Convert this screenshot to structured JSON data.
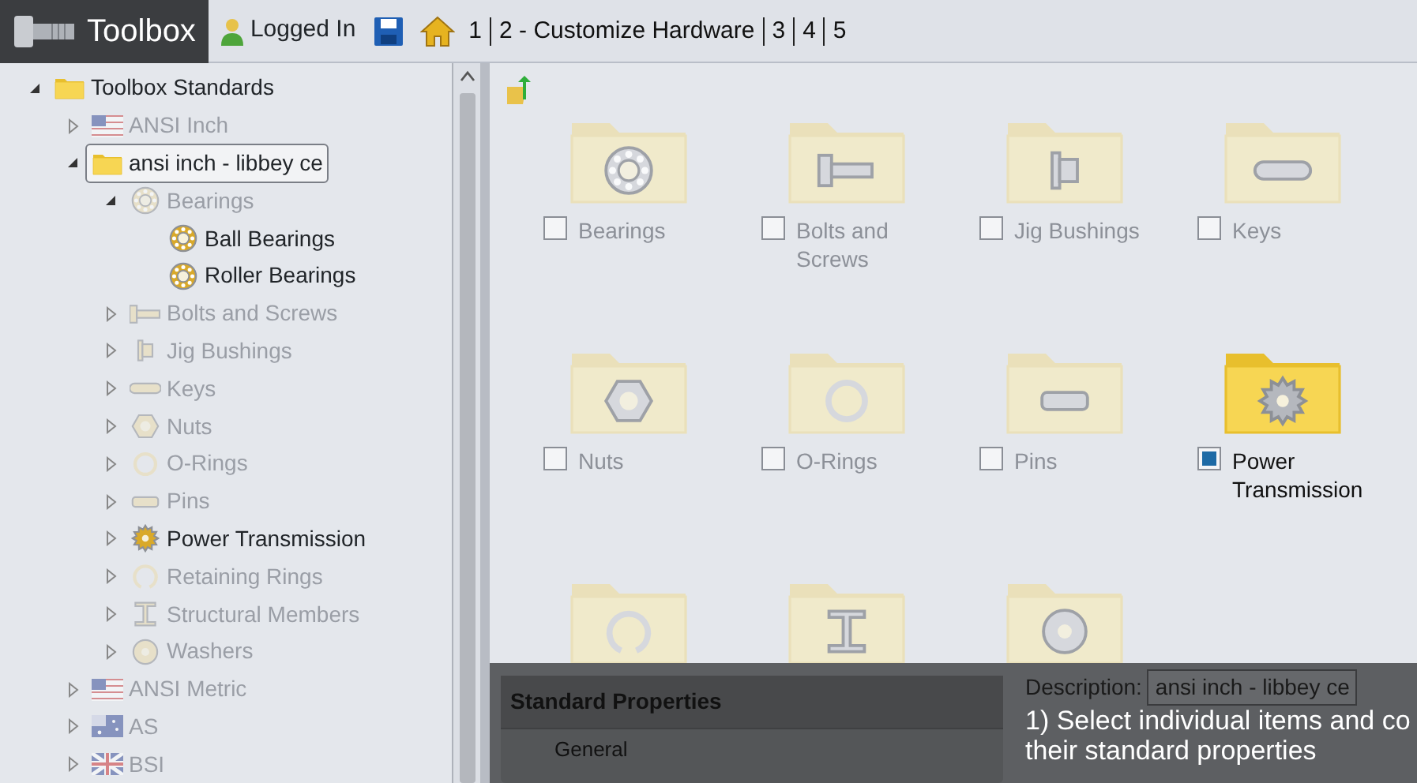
{
  "header": {
    "title": "Toolbox",
    "login": "Logged In",
    "steps": [
      {
        "label": "1"
      },
      {
        "label": "2 - Customize Hardware"
      },
      {
        "label": "3"
      },
      {
        "label": "4"
      },
      {
        "label": "5"
      }
    ]
  },
  "tree": [
    {
      "label": "Toolbox Standards",
      "enabled": true,
      "expanded": true,
      "selected": false,
      "children": [
        {
          "label": "ANSI Inch",
          "enabled": false,
          "expanded": false,
          "selected": false
        },
        {
          "label": "ansi inch - libbey ce",
          "enabled": true,
          "expanded": true,
          "selected": true,
          "children": [
            {
              "label": "Bearings",
              "enabled": false,
              "expanded": true,
              "selected": false,
              "children": [
                {
                  "label": "Ball Bearings",
                  "enabled": true,
                  "selected": false
                },
                {
                  "label": "Roller Bearings",
                  "enabled": true,
                  "selected": false
                }
              ]
            },
            {
              "label": "Bolts and Screws",
              "enabled": false,
              "expanded": false,
              "selected": false
            },
            {
              "label": "Jig Bushings",
              "enabled": false,
              "expanded": false,
              "selected": false
            },
            {
              "label": "Keys",
              "enabled": false,
              "expanded": false,
              "selected": false
            },
            {
              "label": "Nuts",
              "enabled": false,
              "expanded": false,
              "selected": false
            },
            {
              "label": "O-Rings",
              "enabled": false,
              "expanded": false,
              "selected": false
            },
            {
              "label": "Pins",
              "enabled": false,
              "expanded": false,
              "selected": false
            },
            {
              "label": "Power Transmission",
              "enabled": true,
              "expanded": false,
              "selected": false
            },
            {
              "label": "Retaining Rings",
              "enabled": false,
              "expanded": false,
              "selected": false
            },
            {
              "label": "Structural Members",
              "enabled": false,
              "expanded": false,
              "selected": false
            },
            {
              "label": "Washers",
              "enabled": false,
              "expanded": false,
              "selected": false
            }
          ]
        },
        {
          "label": "ANSI Metric",
          "enabled": false,
          "expanded": false,
          "selected": false
        },
        {
          "label": "AS",
          "enabled": false,
          "expanded": false,
          "selected": false
        },
        {
          "label": "BSI",
          "enabled": false,
          "expanded": false,
          "selected": false
        }
      ]
    }
  ],
  "grid": [
    {
      "label": "Bearings",
      "enabled": false,
      "checked": false
    },
    {
      "label": "Bolts and Screws",
      "enabled": false,
      "checked": false
    },
    {
      "label": "Jig Bushings",
      "enabled": false,
      "checked": false
    },
    {
      "label": "Keys",
      "enabled": false,
      "checked": false
    },
    {
      "label": "Nuts",
      "enabled": false,
      "checked": false
    },
    {
      "label": "O-Rings",
      "enabled": false,
      "checked": false
    },
    {
      "label": "Pins",
      "enabled": false,
      "checked": false
    },
    {
      "label": "Power Transmission",
      "enabled": true,
      "checked": true
    },
    {
      "enabled": false
    },
    {
      "enabled": false
    },
    {
      "enabled": false
    }
  ],
  "properties": {
    "title": "Standard Properties",
    "items": [
      {
        "label": "General",
        "selected": false
      }
    ],
    "description_label": "Description:",
    "description_value": "ansi inch - libbey ce"
  },
  "hint": [
    "1) Select individual items and co",
    "their standard properties"
  ]
}
